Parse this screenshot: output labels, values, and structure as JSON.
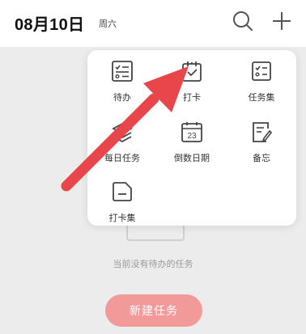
{
  "header": {
    "date": "08月10日",
    "weekday": "周六",
    "search_icon": "search-icon",
    "add_icon": "plus-icon"
  },
  "popup_menu": {
    "items": [
      {
        "label": "待办",
        "icon": "todo-list-icon"
      },
      {
        "label": "打卡",
        "icon": "check-in-clipboard-icon"
      },
      {
        "label": "任务集",
        "icon": "task-set-icon"
      },
      {
        "label": "每日任务",
        "icon": "daily-task-stack-icon"
      },
      {
        "label": "倒数日期",
        "icon": "countdown-calendar-icon"
      },
      {
        "label": "备忘",
        "icon": "memo-edit-icon"
      },
      {
        "label": "打卡集",
        "icon": "check-in-folder-icon"
      }
    ]
  },
  "empty_state": {
    "message": "当前没有待办的任务"
  },
  "new_task_button": {
    "label": "新建任务"
  },
  "colors": {
    "accent": "#f29a9a",
    "annotation_arrow": "#e8464a",
    "background": "#ececec"
  }
}
